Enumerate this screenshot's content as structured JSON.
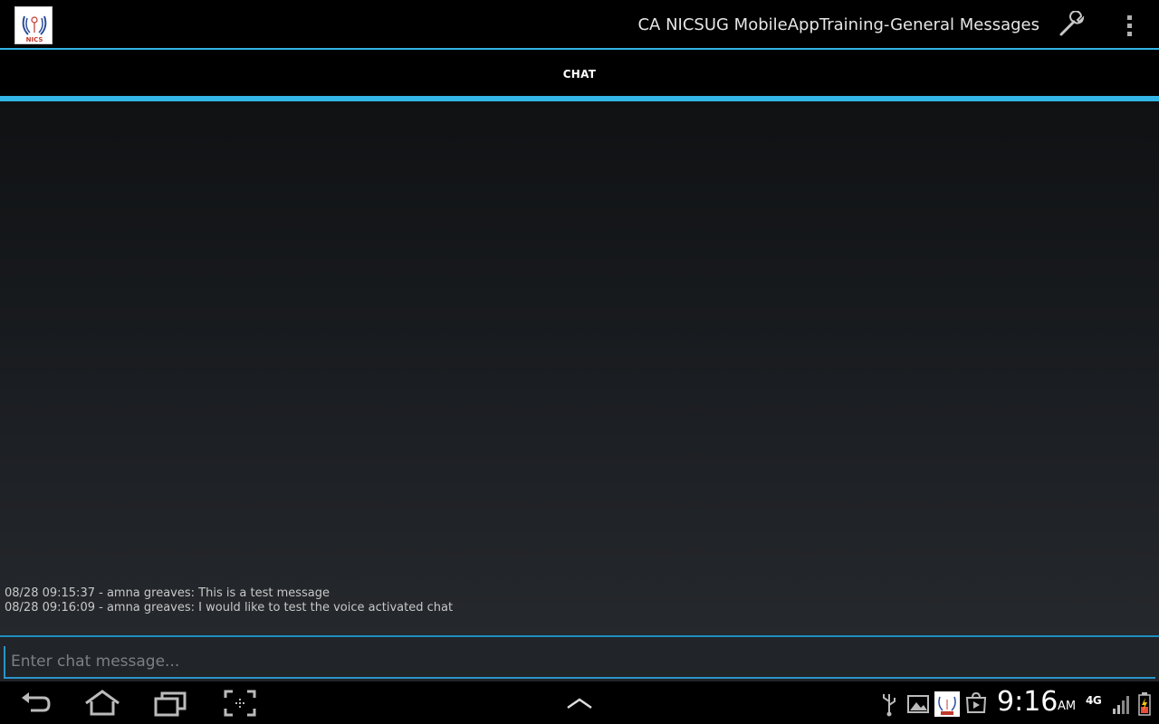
{
  "app": {
    "title": "CA NICSUG MobileAppTraining-General Messages",
    "logo_text": "NICS"
  },
  "tabs": [
    {
      "label": "CHAT",
      "selected": true
    }
  ],
  "chat": {
    "messages": [
      "08/28 09:15:37 - amna greaves: This is a test message",
      "08/28 09:16:09 - amna greaves: I would like to test the voice activated chat"
    ],
    "input_placeholder": "Enter chat message..."
  },
  "status_bar": {
    "time": "9:16",
    "ampm": "AM",
    "network": "4G",
    "icons": [
      "usb-icon",
      "gallery-icon",
      "nics-app-icon",
      "play-store-icon",
      "signal-icon",
      "battery-icon"
    ]
  },
  "colors": {
    "accent": "#33b5e5",
    "background": "#000000"
  }
}
